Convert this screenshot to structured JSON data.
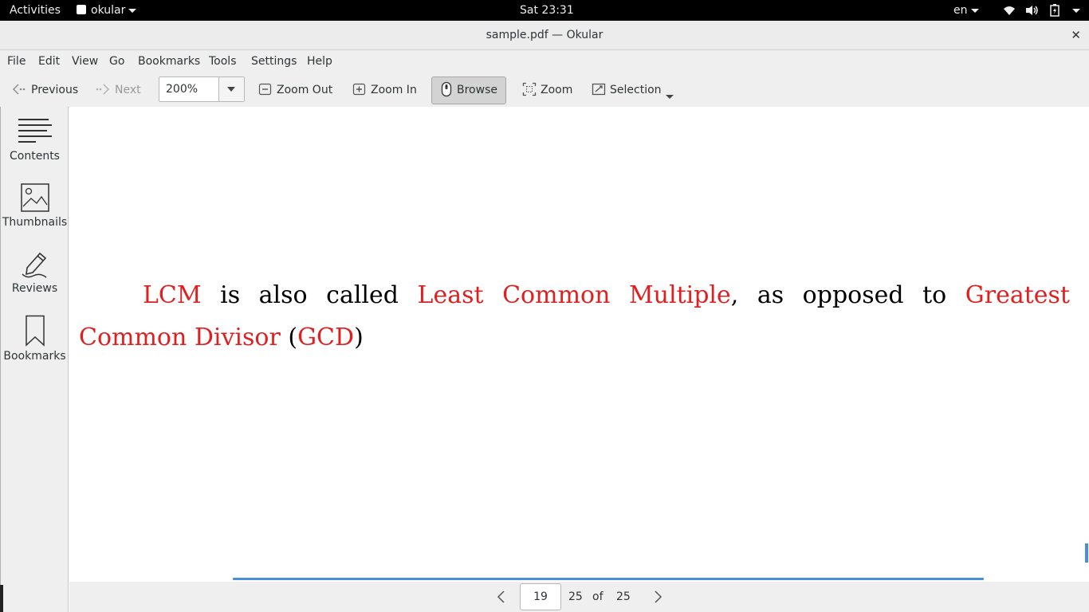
{
  "topbar": {
    "activities": "Activities",
    "app_name": "okular",
    "clock": "Sat 23:31",
    "language": "en"
  },
  "window": {
    "title": "sample.pdf — Okular",
    "close_glyph": "✕"
  },
  "menu": [
    "File",
    "Edit",
    "View",
    "Go",
    "Bookmarks",
    "Tools",
    "Settings",
    "Help"
  ],
  "toolbar": {
    "previous": "Previous",
    "next": "Next",
    "zoom_value": "200%",
    "zoom_out": "Zoom Out",
    "zoom_in": "Zoom In",
    "browse": "Browse",
    "zoom": "Zoom",
    "selection": "Selection"
  },
  "sidebar": {
    "items": [
      {
        "label": "Contents",
        "icon": "contents-icon"
      },
      {
        "label": "Thumbnails",
        "icon": "thumbnails-icon"
      },
      {
        "label": "Reviews",
        "icon": "reviews-icon"
      },
      {
        "label": "Bookmarks",
        "icon": "bookmarks-icon"
      }
    ]
  },
  "document": {
    "parts": [
      "LCM",
      " is also called ",
      "Least Common Multiple",
      ", as opposed to ",
      "Greatest Common Divisor",
      " (",
      "GCD",
      ")"
    ],
    "link_color": "#e02020"
  },
  "pager": {
    "current_page": "19",
    "page_label": "25",
    "of": "of",
    "total_pages": "25"
  },
  "colors": {
    "accent": "#4a90d9",
    "panel": "#000000",
    "chrome": "#efefef"
  }
}
